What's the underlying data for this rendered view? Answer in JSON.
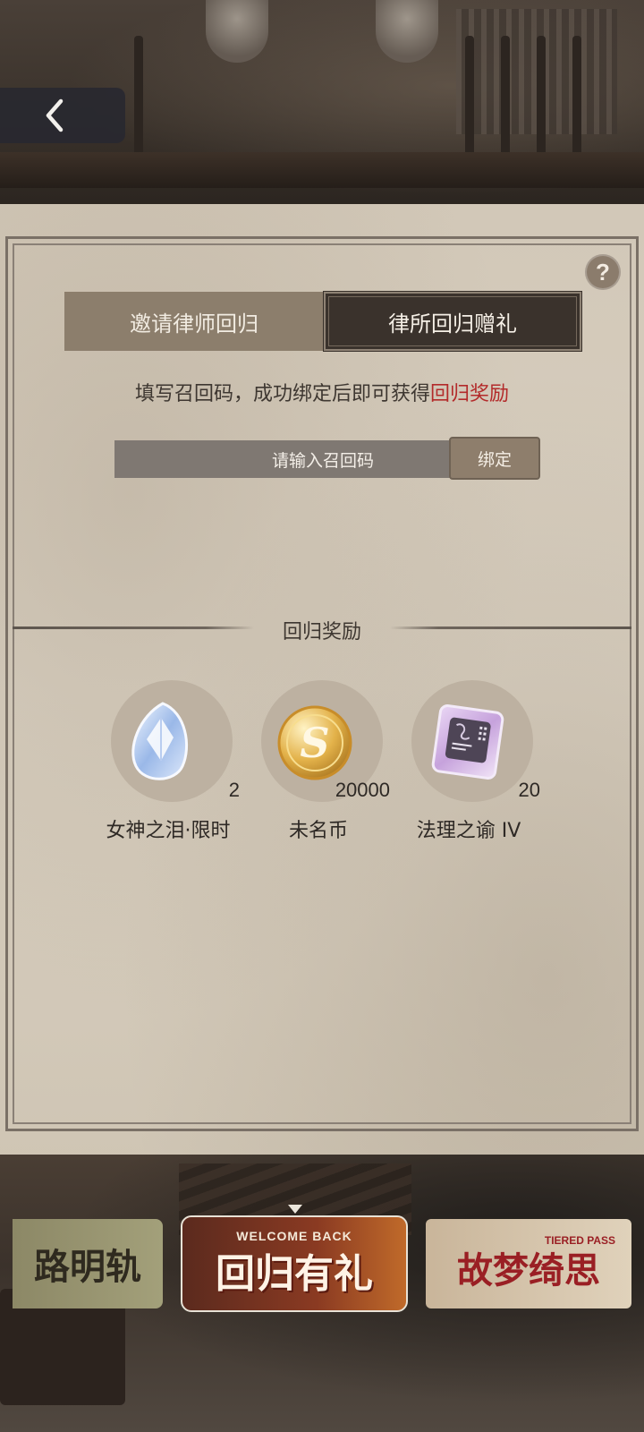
{
  "nav": {
    "back_icon": "chevron-left-icon"
  },
  "help": {
    "label": "?"
  },
  "tabs": [
    {
      "label": "邀请律师回归",
      "active": false
    },
    {
      "label": "律所回归赠礼",
      "active": true
    }
  ],
  "instruction": {
    "text": "填写召回码，成功绑定后即可获得",
    "highlight": "回归奖励",
    "highlight_color": "#b32a2a"
  },
  "code_input": {
    "placeholder": "请输入召回码",
    "value": ""
  },
  "bind_button": {
    "label": "绑定"
  },
  "rewards_section": {
    "title": "回归奖励",
    "items": [
      {
        "name": "女神之泪·限时",
        "count": "2",
        "icon": "crystal-gem-icon"
      },
      {
        "name": "未名币",
        "count": "20000",
        "icon": "gold-coin-icon"
      },
      {
        "name": "法理之谕 IV",
        "count": "20",
        "icon": "card-chip-icon"
      }
    ]
  },
  "banners": [
    {
      "text": "路明轨"
    },
    {
      "sub": "WELCOME BACK",
      "text": "回归有礼",
      "selected": true
    },
    {
      "sub": "TIERED PASS",
      "text": "故梦绮思"
    }
  ]
}
